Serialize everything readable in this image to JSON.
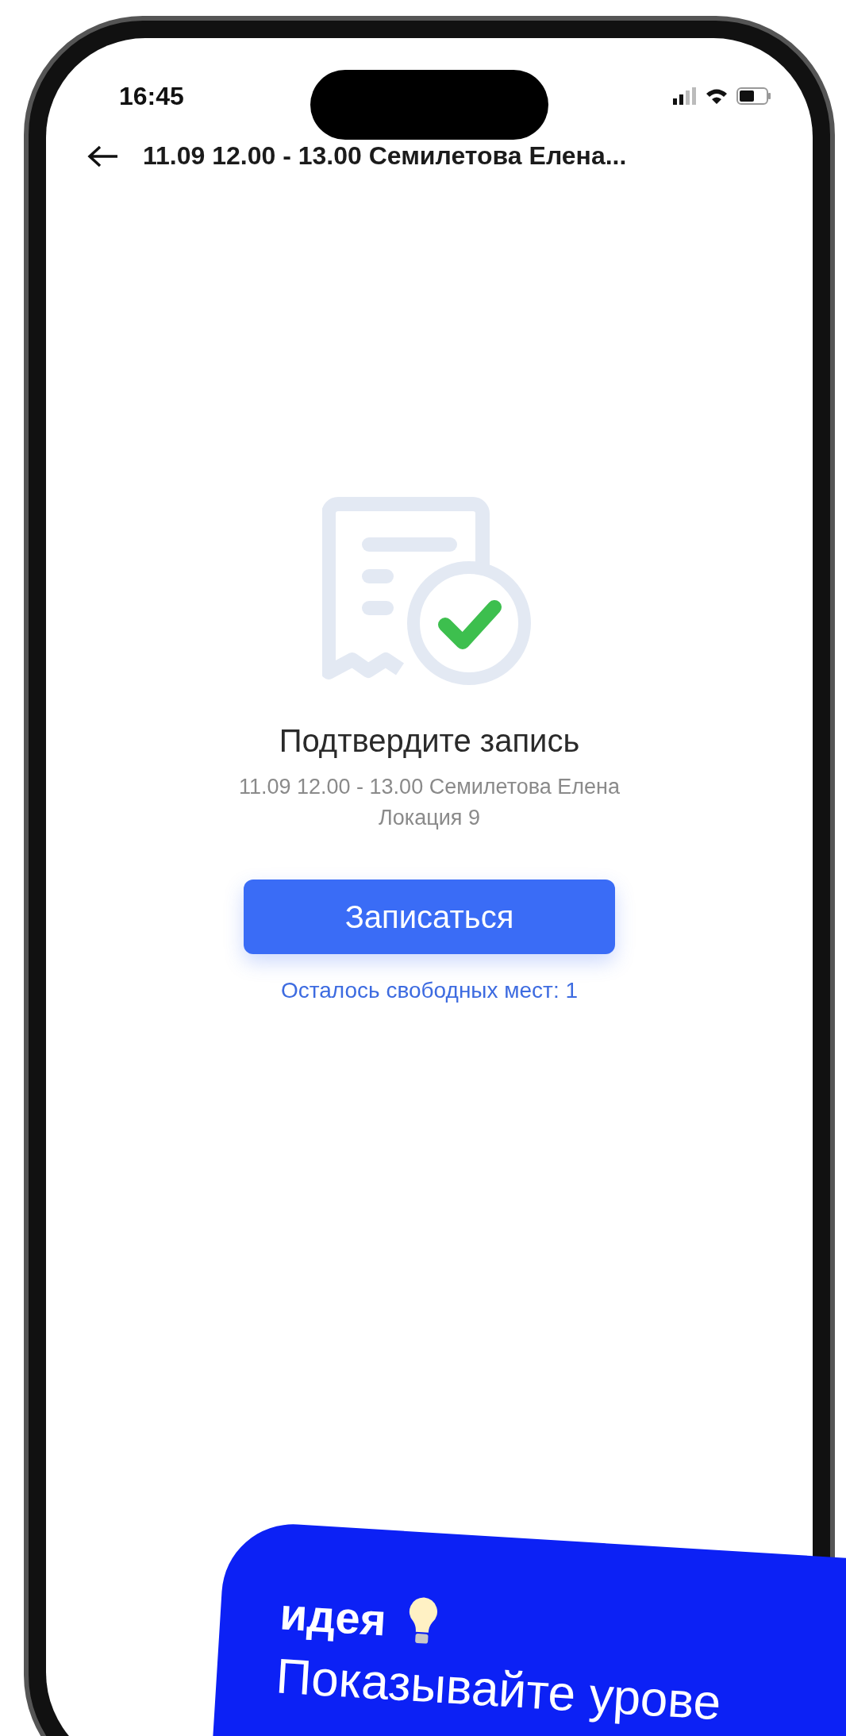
{
  "status_bar": {
    "time": "16:45"
  },
  "header": {
    "title": "11.09 12.00 - 13.00 Семилетова Елена..."
  },
  "confirmation": {
    "title": "Подтвердите запись",
    "details": [
      "11.09 12.00 - 13.00 Семилетова Елена",
      "Локация 9"
    ],
    "button": "Записаться",
    "seats_left": "Осталось свободных мест: 1"
  },
  "tip_banner": {
    "heading": "идея",
    "text": "Показывайте урове"
  }
}
